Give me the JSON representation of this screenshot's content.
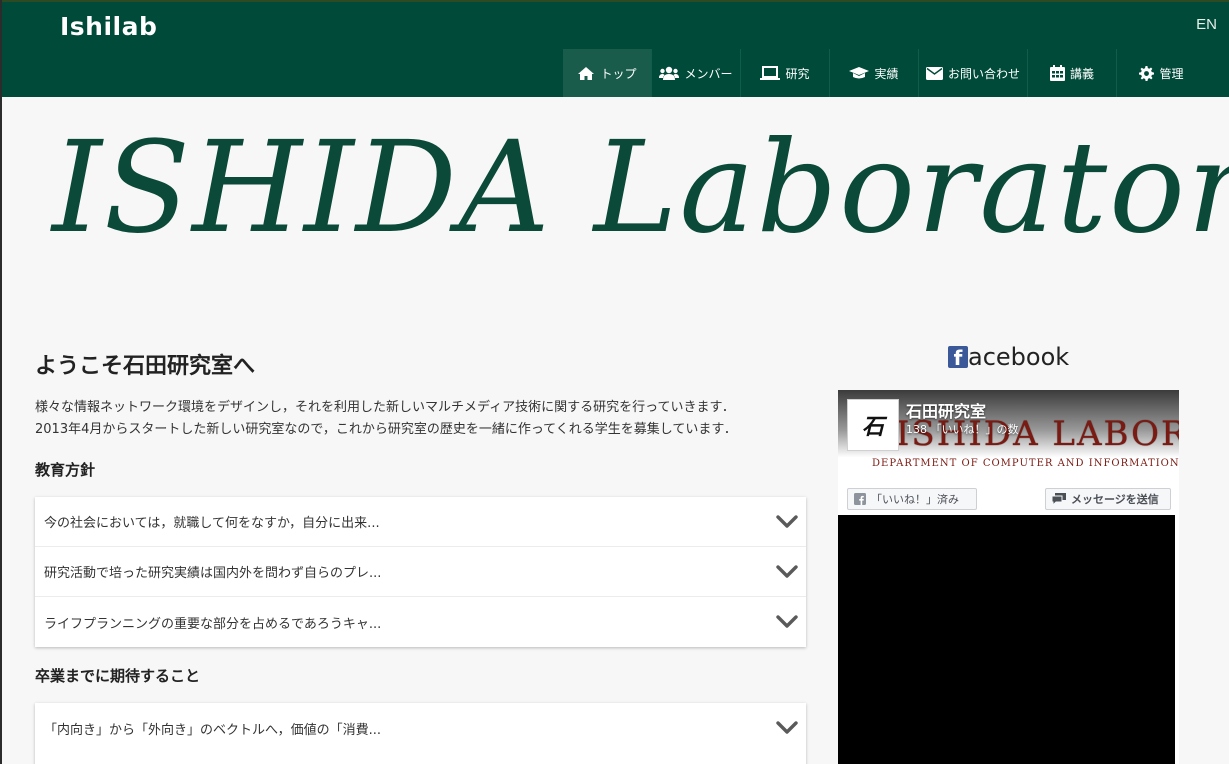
{
  "navbar": {
    "brand": "Ishilab",
    "lang": "EN",
    "items": [
      {
        "label": "トップ",
        "icon": "home-icon",
        "active": true
      },
      {
        "label": "メンバー",
        "icon": "users-icon",
        "active": false
      },
      {
        "label": "研究",
        "icon": "laptop-icon",
        "active": false
      },
      {
        "label": "実績",
        "icon": "graduation-cap-icon",
        "active": false
      },
      {
        "label": "お問い合わせ",
        "icon": "envelope-icon",
        "active": false
      },
      {
        "label": "講義",
        "icon": "calendar-icon",
        "active": false
      },
      {
        "label": "管理",
        "icon": "gear-icon",
        "active": false
      }
    ]
  },
  "banner": {
    "title": "ISHIDA Laboratory"
  },
  "main": {
    "welcome_title": "ようこそ石田研究室へ",
    "intro_lines": [
      "様々な情報ネットワーク環境をデザインし，それを利用した新しいマルチメディア技術に関する研究を行っていきます．",
      "2013年4月からスタートした新しい研究室なので，これから研究室の歴史を一緒に作ってくれる学生を募集しています．"
    ],
    "policy_title": "教育方針",
    "policy_items": [
      "今の社会においては，就職して何をなすか，自分に出来...",
      "研究活動で培った研究実績は国内外を問わず自らのプレ...",
      "ライフプランニングの重要な部分を占めるであろうキャ..."
    ],
    "expect_title": "卒業までに期待すること",
    "expect_items": [
      "「内向き」から「外向き」のベクトルへ，価値の「消費..."
    ]
  },
  "facebook": {
    "title_letter": "f",
    "title_rest": "acebook",
    "page_name": "石田研究室",
    "likes_text": "138 「いいね！」の数",
    "cover_text": "ISHIDA LABORATORY",
    "cover_sub": "DEPARTMENT OF COMPUTER AND INFORMATION SCIENCES",
    "avatar_text": "石",
    "liked_button": "「いいね！」済み",
    "message_button": "メッセージを送信"
  },
  "colors": {
    "navbar_bg": "#004a3a",
    "nav_active_bg": "#1a5c4c",
    "banner_text": "#0b4a38",
    "facebook_blue": "#3b5998"
  }
}
